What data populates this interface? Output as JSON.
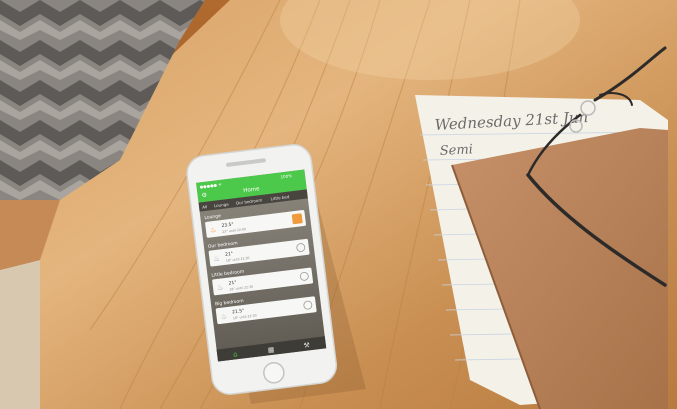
{
  "scene": {
    "description_colors": {
      "wood": "#c98f52",
      "wood_light": "#e3b47c",
      "phone_body": "#f2f2f0",
      "app_green": "#4cc84a",
      "notebook_cover": "#b9835a",
      "paper": "#f4f1e8",
      "handwriting": "#555555"
    }
  },
  "phone": {
    "status_left": "●●●●● ᯤ",
    "status_right": "100%",
    "app_title": "Home",
    "tabs": [
      "All",
      "Lounge",
      "Our bedroom",
      "Little bed"
    ],
    "rooms": [
      {
        "name": "Lounge",
        "temp": "23.5°",
        "sub": "23° until 22:00",
        "active": true
      },
      {
        "name": "Our bedroom",
        "temp": "21°",
        "sub": "18° until 22:30",
        "active": false
      },
      {
        "name": "Little bedroom",
        "temp": "21°",
        "sub": "18° until 22:30",
        "active": false
      },
      {
        "name": "Big bedroom",
        "temp": "21.5°",
        "sub": "18° until 22:30",
        "active": false
      }
    ],
    "nav_icons": [
      "home-icon",
      "grid-icon",
      "settings-icon"
    ]
  },
  "notebook": {
    "handwriting_line1": "Wednesday 21st Jun",
    "handwriting_line2": "Semi"
  }
}
